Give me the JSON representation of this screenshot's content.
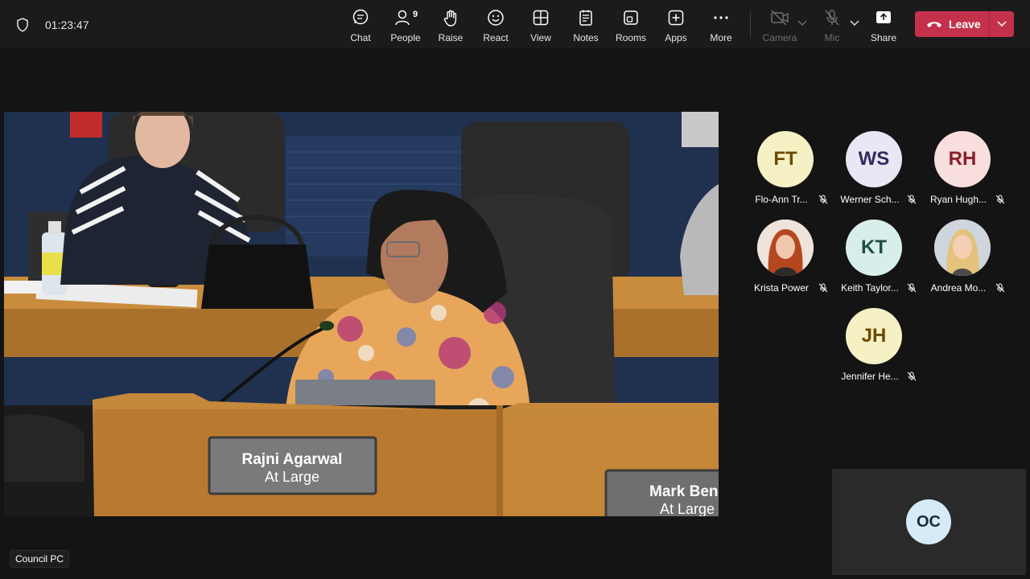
{
  "meeting": {
    "timer": "01:23:47"
  },
  "toolbar": {
    "chat": "Chat",
    "people": "People",
    "people_count": "9",
    "raise": "Raise",
    "react": "React",
    "view": "View",
    "notes": "Notes",
    "rooms": "Rooms",
    "apps": "Apps",
    "more": "More",
    "camera": "Camera",
    "mic": "Mic",
    "share": "Share",
    "leave": "Leave"
  },
  "stage": {
    "nameplate_1_name": "Rajni Agarwal",
    "nameplate_1_role": "At Large",
    "nameplate_2_name": "Mark Ben",
    "nameplate_2_role": "At Large",
    "label": "Council PC"
  },
  "participants": [
    {
      "initials": "FT",
      "name": "Flo-Ann Tr...",
      "color": "#f6f1c5",
      "text_color": "#6b4a00",
      "muted": true
    },
    {
      "initials": "WS",
      "name": "Werner Sch...",
      "color": "#ebe6f5",
      "text_color": "#33295e",
      "muted": true
    },
    {
      "initials": "RH",
      "name": "Ryan Hugh...",
      "color": "#f9dede",
      "text_color": "#8a1f2a",
      "muted": true
    },
    {
      "initials": "",
      "name": "Krista Power",
      "color": "#e9d8cf",
      "text_color": "#000000",
      "muted": true,
      "photo": "red-hair"
    },
    {
      "initials": "KT",
      "name": "Keith Taylor...",
      "color": "#d8eeeb",
      "text_color": "#1f4d46",
      "muted": true
    },
    {
      "initials": "",
      "name": "Andrea Mo...",
      "color": "#e3e6ea",
      "text_color": "#000000",
      "muted": true,
      "photo": "blonde"
    },
    {
      "initials": "JH",
      "name": "Jennifer He...",
      "color": "#f6f1c5",
      "text_color": "#6b4a00",
      "muted": true
    }
  ],
  "self": {
    "initials": "OC"
  },
  "colors": {
    "leave_button": "#c4314b",
    "toolbar_bg": "#1b1b1b",
    "page_bg": "#141414"
  },
  "icons": [
    "shield-icon",
    "chat-icon",
    "people-icon",
    "raise-hand-icon",
    "react-icon",
    "view-icon",
    "notes-icon",
    "rooms-icon",
    "apps-icon",
    "more-icon",
    "camera-off-icon",
    "mic-off-icon",
    "share-icon",
    "phone-icon",
    "chevron-down-icon",
    "mic-muted-icon"
  ]
}
